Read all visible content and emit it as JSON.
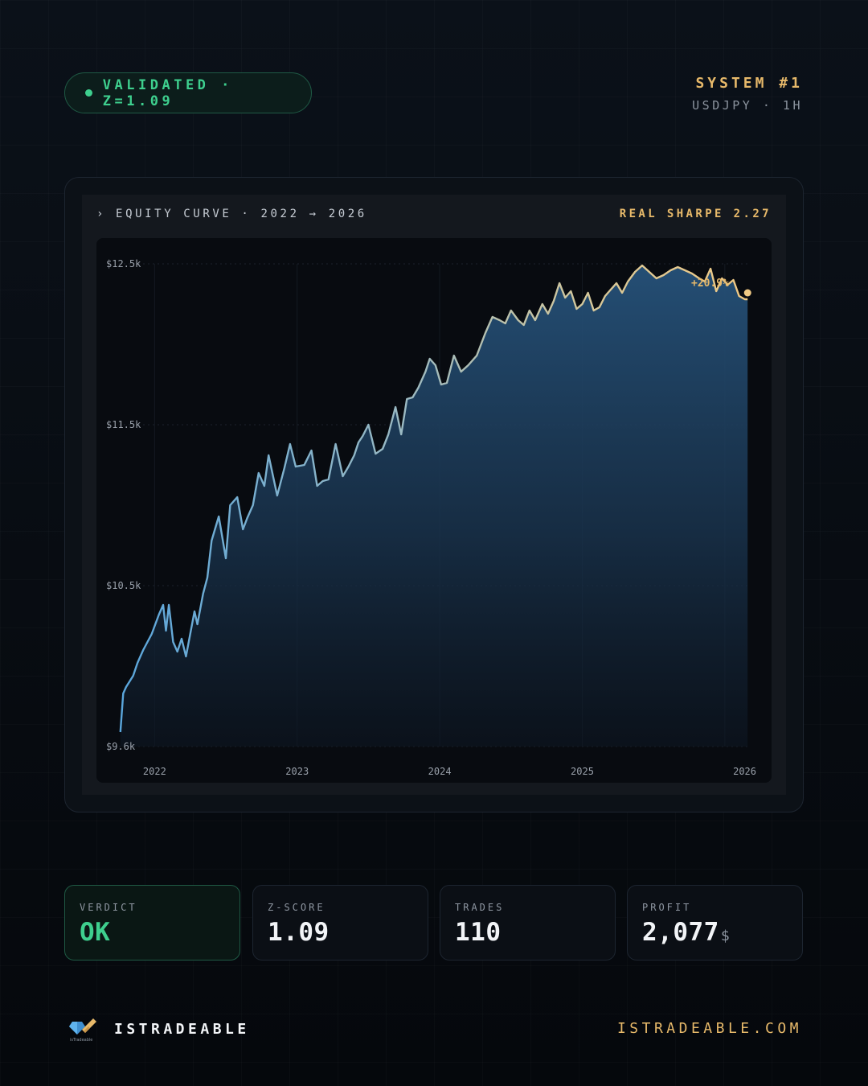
{
  "header": {
    "badge": "VALIDATED · Z=1.09",
    "system": "SYSTEM #1",
    "instrument": "USDJPY · 1H"
  },
  "panel": {
    "title": "› EQUITY CURVE · 2022 → 2026",
    "sharpe": "REAL SHARPE 2.27",
    "peak_label": "+20.9%"
  },
  "chart_data": {
    "type": "area",
    "title": "EQUITY CURVE · 2022 → 2026",
    "y_ticks": [
      {
        "label": "$12.5k",
        "value": 12500
      },
      {
        "label": "$11.5k",
        "value": 11500
      },
      {
        "label": "$10.5k",
        "value": 10500
      },
      {
        "label": "$9.6k",
        "value": 9500
      }
    ],
    "x_ticks": [
      {
        "label": "2022",
        "value": 2022
      },
      {
        "label": "2023",
        "value": 2023
      },
      {
        "label": "2024",
        "value": 2024
      },
      {
        "label": "2025",
        "value": 2025
      },
      {
        "label": "2026",
        "value": 2026
      }
    ],
    "ylim": [
      9500,
      12500
    ],
    "xlim": [
      2021.75,
      2026.17
    ],
    "series": [
      {
        "x": [
          2021.76,
          2021.78,
          2021.8,
          2021.85,
          2021.88,
          2021.92,
          2021.98,
          2022.03,
          2022.06,
          2022.08,
          2022.1,
          2022.13,
          2022.16,
          2022.19,
          2022.22,
          2022.25,
          2022.28,
          2022.3,
          2022.34,
          2022.37,
          2022.4,
          2022.45,
          2022.5,
          2022.53,
          2022.58,
          2022.62,
          2022.65,
          2022.69,
          2022.73,
          2022.77,
          2022.8,
          2022.86,
          2022.91,
          2022.95,
          2022.99,
          2023.05,
          2023.1,
          2023.14,
          2023.18,
          2023.22,
          2023.27,
          2023.32,
          2023.36,
          2023.4,
          2023.43,
          2023.46,
          2023.5,
          2023.55,
          2023.6,
          2023.64,
          2023.69,
          2023.73,
          2023.77,
          2023.81,
          2023.85,
          2023.9,
          2023.93,
          2023.97,
          2024.01,
          2024.05,
          2024.1,
          2024.15,
          2024.2,
          2024.26,
          2024.32,
          2024.37,
          2024.42,
          2024.46,
          2024.5,
          2024.55,
          2024.59,
          2024.63,
          2024.67,
          2024.72,
          2024.76,
          2024.8,
          2024.84,
          2024.88,
          2024.92,
          2024.96,
          2025.0,
          2025.04,
          2025.08,
          2025.12,
          2025.16,
          2025.2,
          2025.24,
          2025.28,
          2025.32,
          2025.37,
          2025.42,
          2025.47,
          2025.52,
          2025.57,
          2025.62,
          2025.67,
          2025.72,
          2025.77,
          2025.82,
          2025.86,
          2025.9,
          2025.94,
          2025.98,
          2026.02,
          2026.06,
          2026.1,
          2026.14,
          2026.16
        ],
        "values": [
          9590,
          9830,
          9870,
          9940,
          10020,
          10100,
          10200,
          10320,
          10380,
          10220,
          10380,
          10150,
          10090,
          10170,
          10060,
          10200,
          10340,
          10260,
          10450,
          10550,
          10780,
          10930,
          10670,
          11000,
          11050,
          10850,
          10920,
          11000,
          11200,
          11120,
          11310,
          11060,
          11230,
          11380,
          11240,
          11250,
          11340,
          11120,
          11150,
          11160,
          11380,
          11180,
          11240,
          11310,
          11390,
          11430,
          11500,
          11320,
          11350,
          11440,
          11610,
          11440,
          11660,
          11670,
          11730,
          11830,
          11910,
          11870,
          11750,
          11760,
          11930,
          11830,
          11870,
          11930,
          12070,
          12170,
          12150,
          12130,
          12210,
          12150,
          12120,
          12210,
          12150,
          12250,
          12190,
          12270,
          12380,
          12290,
          12330,
          12220,
          12250,
          12320,
          12210,
          12230,
          12300,
          12340,
          12380,
          12320,
          12390,
          12450,
          12490,
          12450,
          12410,
          12430,
          12460,
          12480,
          12460,
          12440,
          12410,
          12390,
          12470,
          12330,
          12410,
          12370,
          12400,
          12300,
          12280,
          12280
        ]
      }
    ]
  },
  "stats": [
    {
      "label": "VERDICT",
      "value": "OK",
      "unit": ""
    },
    {
      "label": "Z-SCORE",
      "value": "1.09",
      "unit": ""
    },
    {
      "label": "TRADES",
      "value": "110",
      "unit": ""
    },
    {
      "label": "PROFIT",
      "value": "2,077",
      "unit": "$"
    }
  ],
  "footer": {
    "brand": "ISTRADEABLE",
    "logo_caption": "isTradeable",
    "site": "ISTRADEABLE.COM"
  },
  "colors": {
    "accent_gold": "#e7b96a",
    "accent_green": "#3ecf8e",
    "line_blue": "#5aa6dc"
  }
}
